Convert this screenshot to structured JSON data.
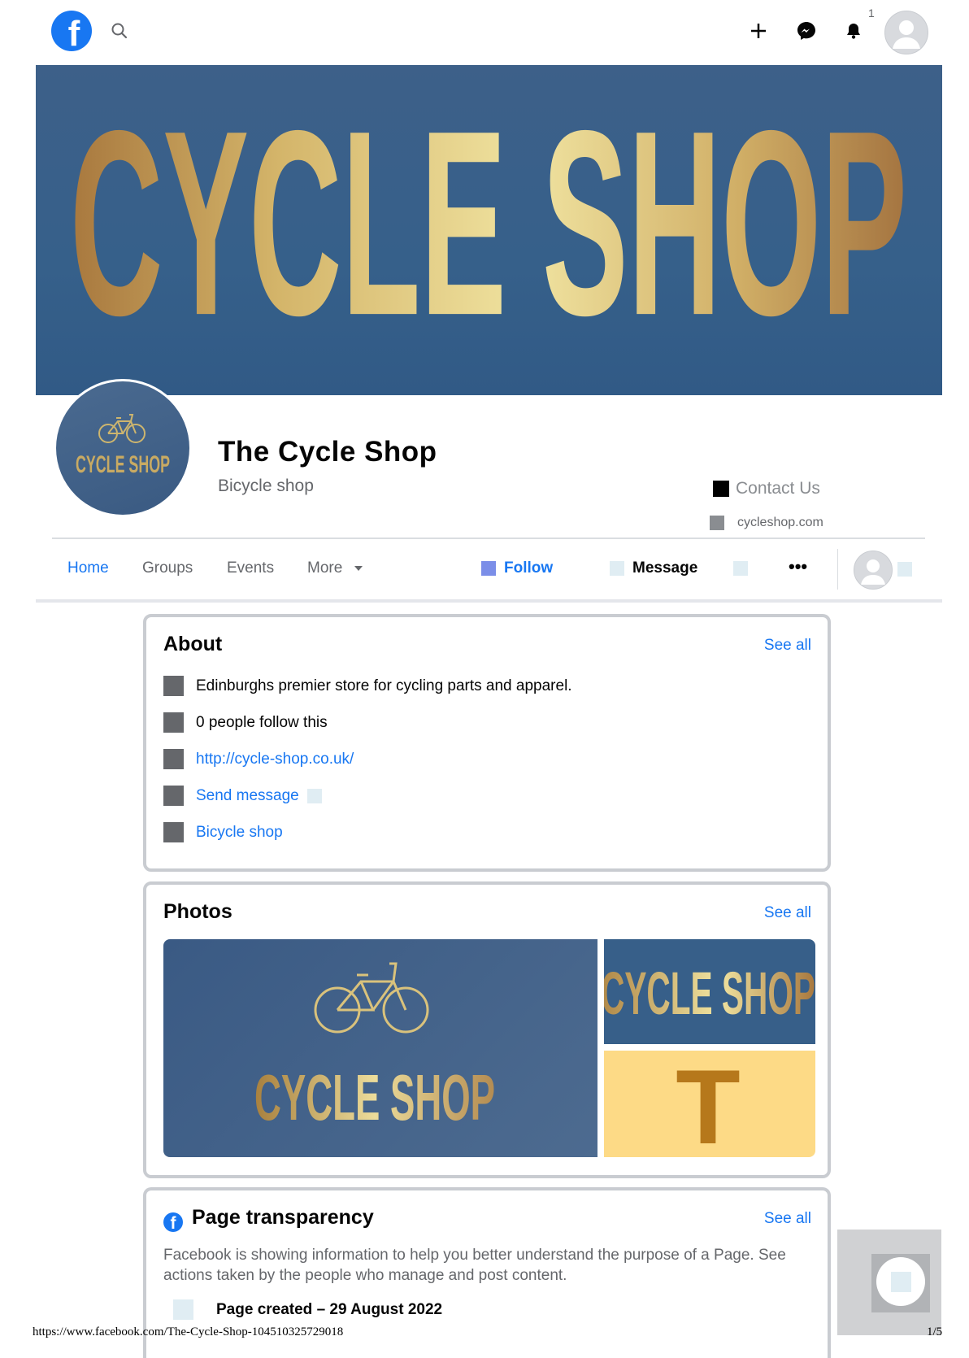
{
  "topbar": {
    "logo_letter": "f",
    "notification_count": "1",
    "icons": [
      "search-icon",
      "plus-icon",
      "messenger-icon",
      "bell-icon",
      "avatar-icon"
    ]
  },
  "cover": {
    "text": "CYCLE SHOP"
  },
  "profile": {
    "logo_text": "CYCLE SHOP",
    "name": "The Cycle Shop",
    "category": "Bicycle shop",
    "contact_label": "Contact Us",
    "website": "cycleshop.com"
  },
  "nav": {
    "tabs": [
      "Home",
      "Groups",
      "Events",
      "More"
    ],
    "follow_label": "Follow",
    "message_label": "Message",
    "more_icon": "•••"
  },
  "about": {
    "title": "About",
    "see_all": "See all",
    "items": [
      "Edinburghs premier store for cycling parts and apparel.",
      "0 people follow this",
      "http://cycle-shop.co.uk/",
      "Send message",
      "Bicycle shop"
    ]
  },
  "photos": {
    "title": "Photos",
    "see_all": "See all",
    "main_text": "CYCLE SHOP",
    "top_text": "CYCLE SHOP",
    "bottom_letter": "T"
  },
  "transparency": {
    "title": "Page transparency",
    "see_all": "See all",
    "description": "Facebook is showing information to help you better understand the purpose of a Page. See actions taken by the people who manage and post content.",
    "created": "Page created – 29 August 2022"
  },
  "footer": {
    "url": "https://www.facebook.com/The-Cycle-Shop-104510325729018",
    "page": "1/5"
  },
  "colors": {
    "fb_blue": "#1877f2",
    "cover_blue": "#3a6089",
    "gold": "#d8b866"
  }
}
